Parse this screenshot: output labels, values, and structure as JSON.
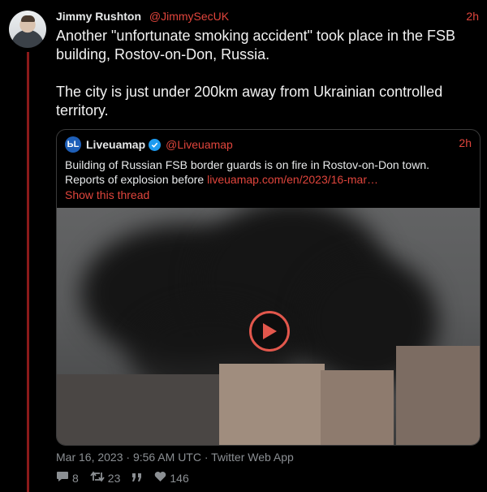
{
  "tweet": {
    "author_name": "Jimmy Rushton",
    "author_handle": "@JimmySecUK",
    "time": "2h",
    "text": "Another \"unfortunate smoking accident\" took place in the FSB building, Rostov-on-Don, Russia.\n\nThe city is just under 200km away from Ukrainian controlled territory.",
    "meta": "Mar 16, 2023 · 9:56 AM UTC · Twitter Web App",
    "replies": "8",
    "retweets": "23",
    "likes": "146"
  },
  "quote": {
    "author_name": "Liveuamap",
    "author_handle": "@Liveuamap",
    "time": "2h",
    "text": "Building of Russian FSB border guards is on fire in Rostov-on-Don town. Reports of explosion before ",
    "link": "liveuamap.com/en/2023/16-mar…",
    "show_thread": "Show this thread"
  },
  "icons": {
    "logo": "liveuamap-logo",
    "verified": "verified-badge-icon",
    "play": "play-icon",
    "reply": "reply-icon",
    "retweet": "retweet-icon",
    "quote": "quote-icon",
    "like": "heart-icon"
  },
  "colors": {
    "accent": "#e0453c",
    "thread_line": "#8b1a1a",
    "verified": "#1d9bf0"
  }
}
